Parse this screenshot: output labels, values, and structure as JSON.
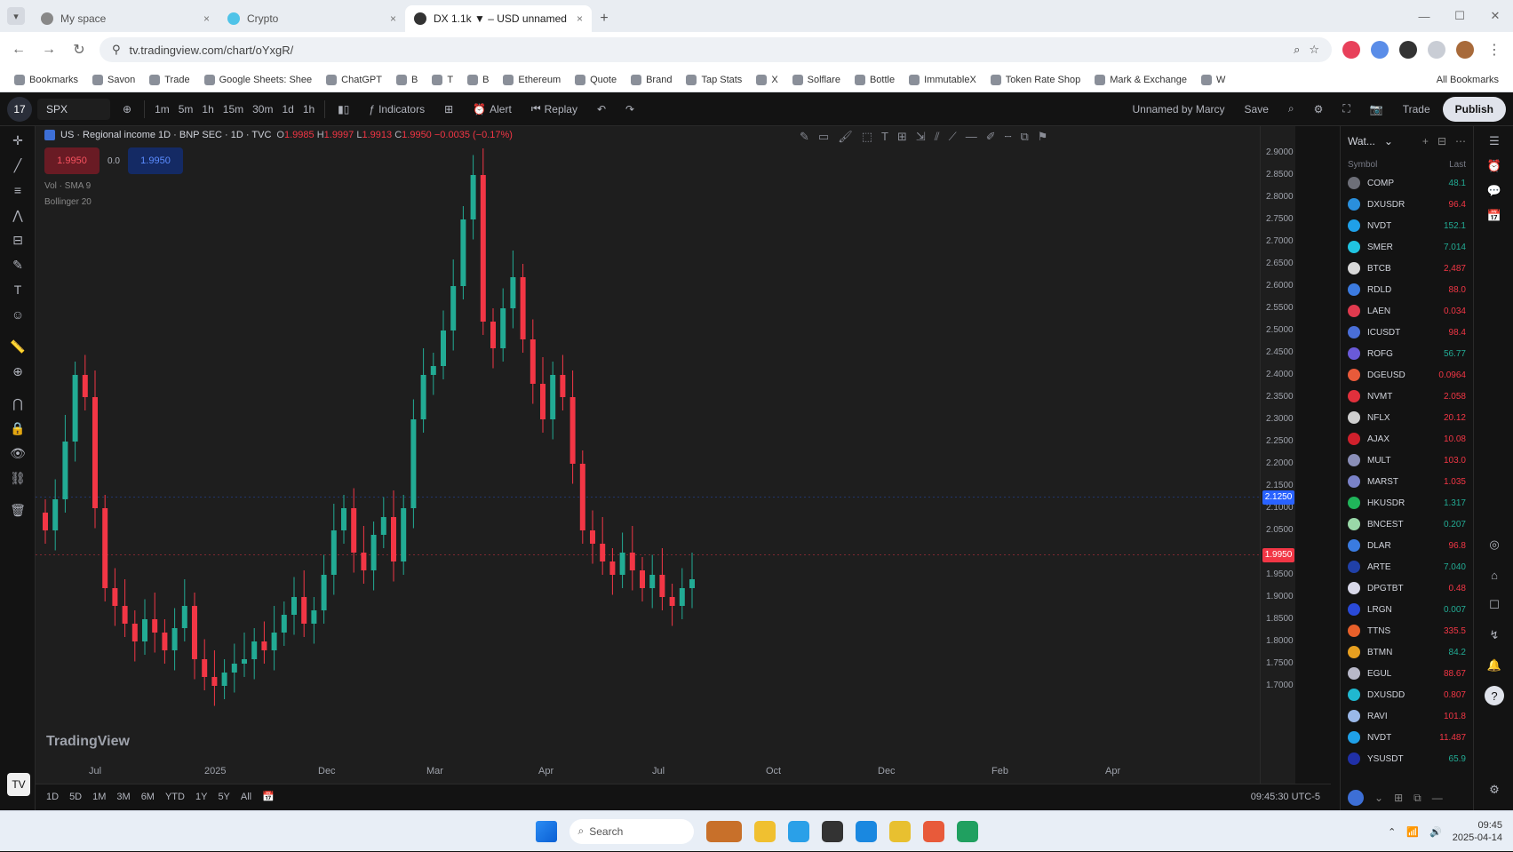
{
  "browser": {
    "tabs": [
      {
        "label": "My space",
        "active": false
      },
      {
        "label": "Crypto",
        "active": false
      },
      {
        "label": "DX 1.1k ▼ – USD unnamed",
        "active": true
      }
    ],
    "new_tab": "+",
    "url": "tv.tradingview.com/chart/oYxgR/",
    "bookmarks": [
      "Bookmarks",
      "Savon",
      "Trade",
      "Google Sheets: Shee",
      "ChatGPT",
      "B",
      "T",
      "B",
      "Ethereum",
      "Quote",
      "Brand",
      "Tap Stats",
      "X",
      "Solflare",
      "Bottle",
      "ImmutableX",
      "Token Rate Shop",
      "Mark & Exchange",
      "W"
    ],
    "bookmarks_right": "All Bookmarks"
  },
  "toolbar": {
    "logo": "17",
    "symbol": "SPX",
    "timeframes": [
      "1m",
      "5m",
      "1h",
      "15m",
      "30m",
      "1d",
      "1h"
    ],
    "indicators_label": "Indicators",
    "alert_label": "Alert",
    "replay_label": "Replay",
    "cross_label": "Unnamed by Marcy",
    "layout_label": "Save",
    "trade_label": "Trade",
    "publish_label": "Publish"
  },
  "legend": {
    "name": "US · Regional income 1D · BNP SEC · 1D · TVC",
    "o_label": "O",
    "o": "1.9985",
    "h_label": "H",
    "h": "1.9997",
    "l_label": "L",
    "l": "1.9913",
    "c_label": "C",
    "c": "1.9950",
    "chg": "−0.0035 (−0.17%)"
  },
  "trade_panel": {
    "sell_label": "1.9950",
    "spread": "0.0",
    "buy_label": "1.9950"
  },
  "indicators": [
    "Vol · SMA 9",
    "Bollinger 20"
  ],
  "watermark": "TradingView",
  "x_axis": [
    "Jul",
    "2025",
    "Dec",
    "Mar",
    "Apr",
    "Jul",
    "Oct",
    "Dec",
    "Feb",
    "Apr"
  ],
  "y_axis": [
    "2.9000",
    "2.8500",
    "2.8000",
    "2.7500",
    "2.7000",
    "2.6500",
    "2.6000",
    "2.5500",
    "2.5000",
    "2.4500",
    "2.4000",
    "2.3500",
    "2.3000",
    "2.2500",
    "2.2000",
    "2.1500",
    "2.1000",
    "2.0500",
    "2.0000",
    "1.9500",
    "1.9000",
    "1.8500",
    "1.8000",
    "1.7500",
    "1.7000"
  ],
  "price_badges": {
    "blue": "2.1250",
    "red": "1.9950"
  },
  "bottom": {
    "ranges": [
      "1D",
      "5D",
      "1M",
      "3M",
      "6M",
      "YTD",
      "1Y",
      "5Y",
      "All"
    ],
    "time": "09:45:30 UTC-5"
  },
  "watchlist": {
    "title": "Wat...",
    "col_symbol": "Symbol",
    "col_price": "Last",
    "rows": [
      {
        "s": "COMP",
        "p": "48.1",
        "dir": "up",
        "c": "#6d6f78"
      },
      {
        "s": "DXUSDR",
        "p": "96.4",
        "dir": "down",
        "c": "#2a8fdc"
      },
      {
        "s": "NVDT",
        "p": "152.1",
        "dir": "up",
        "c": "#1fa0e8"
      },
      {
        "s": "SMER",
        "p": "7.014",
        "dir": "up",
        "c": "#20c4e0"
      },
      {
        "s": "BTCB",
        "p": "2,487",
        "dir": "down",
        "c": "#d8d8d8"
      },
      {
        "s": "RDLD",
        "p": "88.0",
        "dir": "down",
        "c": "#3c7be0"
      },
      {
        "s": "LAEN",
        "p": "0.034",
        "dir": "down",
        "c": "#e03a4e"
      },
      {
        "s": "ICUSDT",
        "p": "98.4",
        "dir": "down",
        "c": "#4a6fd8"
      },
      {
        "s": "ROFG",
        "p": "56.77",
        "dir": "up",
        "c": "#6a5ad8"
      },
      {
        "s": "DGEUSD",
        "p": "0.0964",
        "dir": "down",
        "c": "#e85a3a"
      },
      {
        "s": "NVMT",
        "p": "2.058",
        "dir": "down",
        "c": "#e0303c"
      },
      {
        "s": "NFLX",
        "p": "20.12",
        "dir": "down",
        "c": "#cfcfcf"
      },
      {
        "s": "AJAX",
        "p": "10.08",
        "dir": "down",
        "c": "#d0202c"
      },
      {
        "s": "MULT",
        "p": "103.0",
        "dir": "down",
        "c": "#8a8fb8"
      },
      {
        "s": "MARST",
        "p": "1.035",
        "dir": "down",
        "c": "#7a82c8"
      },
      {
        "s": "HKUSDR",
        "p": "1.317",
        "dir": "up",
        "c": "#20b45a"
      },
      {
        "s": "BNCEST",
        "p": "0.207",
        "dir": "up",
        "c": "#9ad8a8"
      },
      {
        "s": "DLAR",
        "p": "96.8",
        "dir": "down",
        "c": "#3a7be0"
      },
      {
        "s": "ARTE",
        "p": "7.040",
        "dir": "up",
        "c": "#2040a8"
      },
      {
        "s": "DPGTBT",
        "p": "0.48",
        "dir": "down",
        "c": "#d8d8e8"
      },
      {
        "s": "LRGN",
        "p": "0.007",
        "dir": "up",
        "c": "#2a4ad8"
      },
      {
        "s": "TTNS",
        "p": "335.5",
        "dir": "down",
        "c": "#e8602a"
      },
      {
        "s": "BTMN",
        "p": "84.2",
        "dir": "up",
        "c": "#e8a020"
      },
      {
        "s": "EGUL",
        "p": "88.67",
        "dir": "down",
        "c": "#b8b8c8"
      },
      {
        "s": "DXUSDD",
        "p": "0.807",
        "dir": "down",
        "c": "#20b8d0"
      },
      {
        "s": "RAVI",
        "p": "101.8",
        "dir": "down",
        "c": "#9ab8e8"
      },
      {
        "s": "NVDT",
        "p": "11.487",
        "dir": "down",
        "c": "#1fa0e8"
      },
      {
        "s": "YSUSDT",
        "p": "65.9",
        "dir": "up",
        "c": "#2030a8"
      }
    ]
  },
  "taskbar": {
    "search": "Search",
    "clock_time": "09:45",
    "clock_date": "2025-04-14"
  },
  "chart_data": {
    "type": "candlestick",
    "ylim": [
      1.7,
      2.9
    ],
    "candles_close": [
      2.05,
      2.12,
      2.25,
      2.4,
      2.35,
      2.1,
      1.92,
      1.88,
      1.84,
      1.8,
      1.85,
      1.82,
      1.78,
      1.83,
      1.88,
      1.76,
      1.72,
      1.7,
      1.73,
      1.75,
      1.76,
      1.8,
      1.78,
      1.82,
      1.86,
      1.9,
      1.84,
      1.87,
      1.95,
      2.05,
      2.1,
      2.0,
      1.96,
      2.04,
      2.08,
      1.98,
      2.1,
      2.3,
      2.4,
      2.42,
      2.5,
      2.6,
      2.75,
      2.85,
      2.52,
      2.46,
      2.55,
      2.62,
      2.48,
      2.38,
      2.3,
      2.4,
      2.35,
      2.2,
      2.05,
      2.02,
      1.98,
      1.95,
      2.0,
      1.96,
      1.92,
      1.95,
      1.9,
      1.88,
      1.92,
      1.94
    ],
    "colors": {
      "up": "#22ab94",
      "down": "#f23645"
    }
  }
}
